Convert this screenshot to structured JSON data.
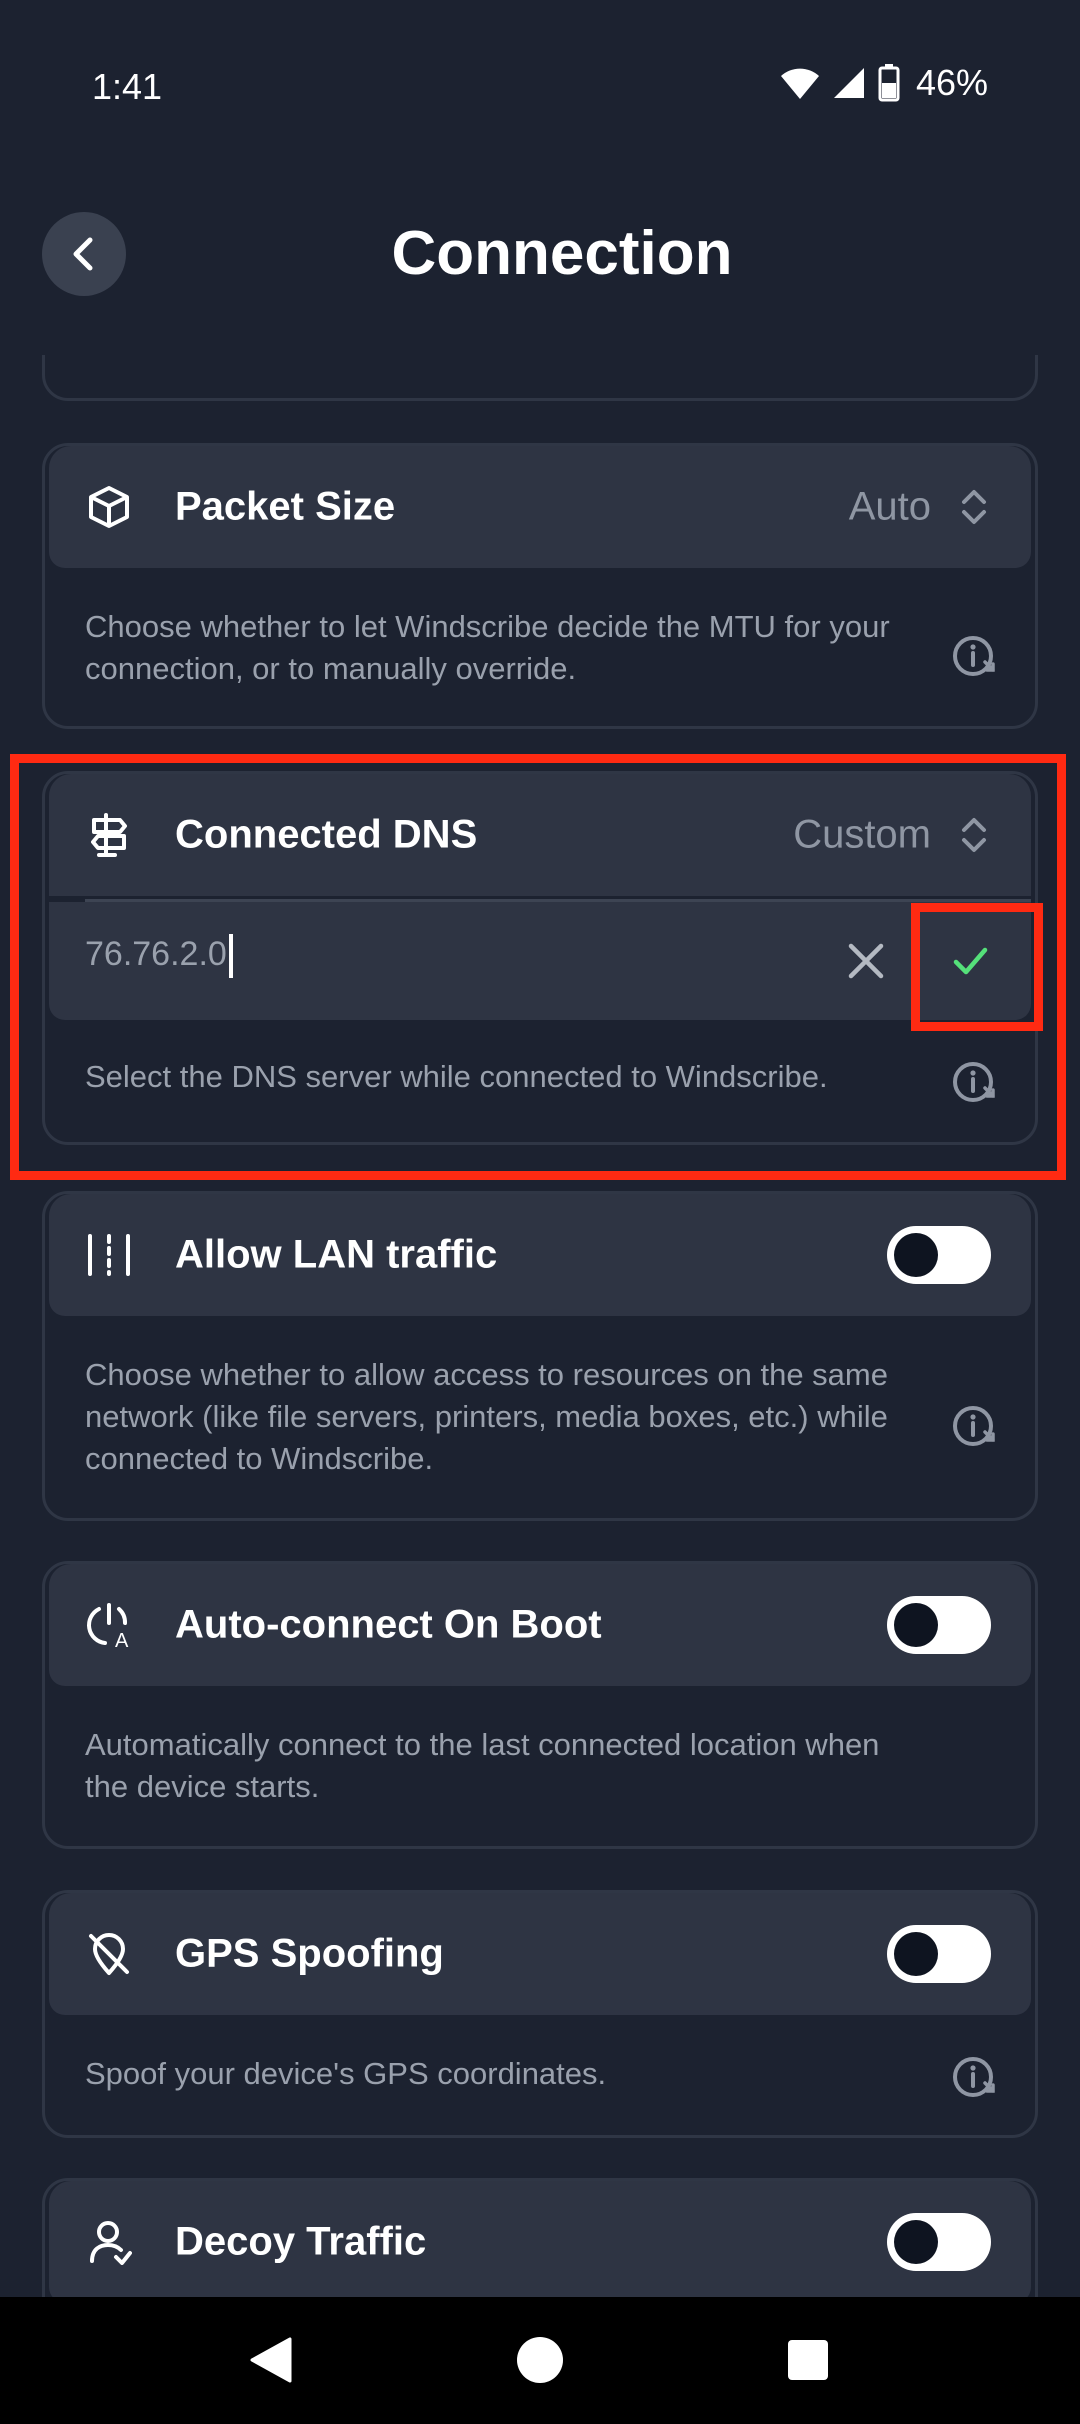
{
  "status": {
    "time": "1:41",
    "battery": "46%"
  },
  "header": {
    "title": "Connection"
  },
  "cards": {
    "packet_size": {
      "title": "Packet Size",
      "value": "Auto",
      "description": "Choose whether to let Windscribe decide the MTU for your connection, or to manually override."
    },
    "connected_dns": {
      "title": "Connected DNS",
      "value": "Custom",
      "input_value": "76.76.2.0",
      "description": "Select the DNS server while connected to Windscribe."
    },
    "allow_lan": {
      "title": "Allow LAN traffic",
      "enabled": false,
      "description": "Choose whether to allow access to resources on the same network (like file servers, printers, media boxes, etc.) while connected to Windscribe."
    },
    "auto_connect": {
      "title": "Auto-connect On Boot",
      "enabled": false,
      "description": "Automatically connect to the last connected location when the device starts."
    },
    "gps_spoofing": {
      "title": "GPS Spoofing",
      "enabled": false,
      "description": "Spoof your device's GPS coordinates."
    },
    "decoy_traffic": {
      "title": "Decoy Traffic",
      "enabled": false
    }
  },
  "colors": {
    "background": "#1c2230",
    "card_header": "#2e3443",
    "accent_check": "#55e07a",
    "highlight": "#ff2a12",
    "toggle_track": "#ffffff"
  }
}
